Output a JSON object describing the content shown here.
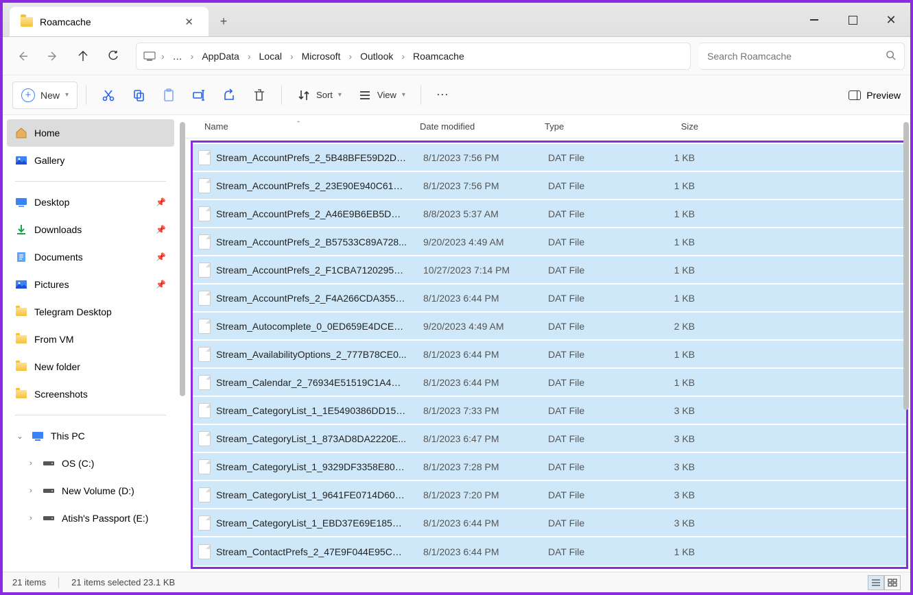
{
  "window": {
    "title": "Roamcache"
  },
  "breadcrumb": [
    "AppData",
    "Local",
    "Microsoft",
    "Outlook",
    "Roamcache"
  ],
  "search": {
    "placeholder": "Search Roamcache"
  },
  "toolbar": {
    "new": "New",
    "sort": "Sort",
    "view": "View",
    "preview": "Preview"
  },
  "sidebar": {
    "home": "Home",
    "gallery": "Gallery",
    "quick": [
      {
        "label": "Desktop",
        "pinned": true,
        "icon": "desktop"
      },
      {
        "label": "Downloads",
        "pinned": true,
        "icon": "downloads"
      },
      {
        "label": "Documents",
        "pinned": true,
        "icon": "documents"
      },
      {
        "label": "Pictures",
        "pinned": true,
        "icon": "pictures"
      },
      {
        "label": "Telegram Desktop",
        "pinned": false,
        "icon": "folder"
      },
      {
        "label": "From VM",
        "pinned": false,
        "icon": "folder"
      },
      {
        "label": "New folder",
        "pinned": false,
        "icon": "folder"
      },
      {
        "label": "Screenshots",
        "pinned": false,
        "icon": "folder"
      }
    ],
    "thispc": "This PC",
    "drives": [
      {
        "label": "OS (C:)"
      },
      {
        "label": "New Volume (D:)"
      },
      {
        "label": "Atish's Passport  (E:)"
      }
    ]
  },
  "columns": {
    "name": "Name",
    "date": "Date modified",
    "type": "Type",
    "size": "Size"
  },
  "files": [
    {
      "name": "Stream_AccountPrefs_2_5B48BFE59D2DD...",
      "date": "8/1/2023 7:56 PM",
      "type": "DAT File",
      "size": "1 KB"
    },
    {
      "name": "Stream_AccountPrefs_2_23E90E940C61A...",
      "date": "8/1/2023 7:56 PM",
      "type": "DAT File",
      "size": "1 KB"
    },
    {
      "name": "Stream_AccountPrefs_2_A46E9B6EB5DB2...",
      "date": "8/8/2023 5:37 AM",
      "type": "DAT File",
      "size": "1 KB"
    },
    {
      "name": "Stream_AccountPrefs_2_B57533C89A728...",
      "date": "9/20/2023 4:49 AM",
      "type": "DAT File",
      "size": "1 KB"
    },
    {
      "name": "Stream_AccountPrefs_2_F1CBA71202957...",
      "date": "10/27/2023 7:14 PM",
      "type": "DAT File",
      "size": "1 KB"
    },
    {
      "name": "Stream_AccountPrefs_2_F4A266CDA355E...",
      "date": "8/1/2023 6:44 PM",
      "type": "DAT File",
      "size": "1 KB"
    },
    {
      "name": "Stream_Autocomplete_0_0ED659E4DCE5...",
      "date": "9/20/2023 4:49 AM",
      "type": "DAT File",
      "size": "2 KB"
    },
    {
      "name": "Stream_AvailabilityOptions_2_777B78CE0...",
      "date": "8/1/2023 6:44 PM",
      "type": "DAT File",
      "size": "1 KB"
    },
    {
      "name": "Stream_Calendar_2_76934E51519C1A4EA...",
      "date": "8/1/2023 6:44 PM",
      "type": "DAT File",
      "size": "1 KB"
    },
    {
      "name": "Stream_CategoryList_1_1E5490386DD152...",
      "date": "8/1/2023 7:33 PM",
      "type": "DAT File",
      "size": "3 KB"
    },
    {
      "name": "Stream_CategoryList_1_873AD8DA2220E...",
      "date": "8/1/2023 6:47 PM",
      "type": "DAT File",
      "size": "3 KB"
    },
    {
      "name": "Stream_CategoryList_1_9329DF3358E801...",
      "date": "8/1/2023 7:28 PM",
      "type": "DAT File",
      "size": "3 KB"
    },
    {
      "name": "Stream_CategoryList_1_9641FE0714D609...",
      "date": "8/1/2023 7:20 PM",
      "type": "DAT File",
      "size": "3 KB"
    },
    {
      "name": "Stream_CategoryList_1_EBD37E69E185B6...",
      "date": "8/1/2023 6:44 PM",
      "type": "DAT File",
      "size": "3 KB"
    },
    {
      "name": "Stream_ContactPrefs_2_47E9F044E95CA0...",
      "date": "8/1/2023 6:44 PM",
      "type": "DAT File",
      "size": "1 KB"
    }
  ],
  "status": {
    "count": "21 items",
    "selected": "21 items selected  23.1 KB"
  }
}
